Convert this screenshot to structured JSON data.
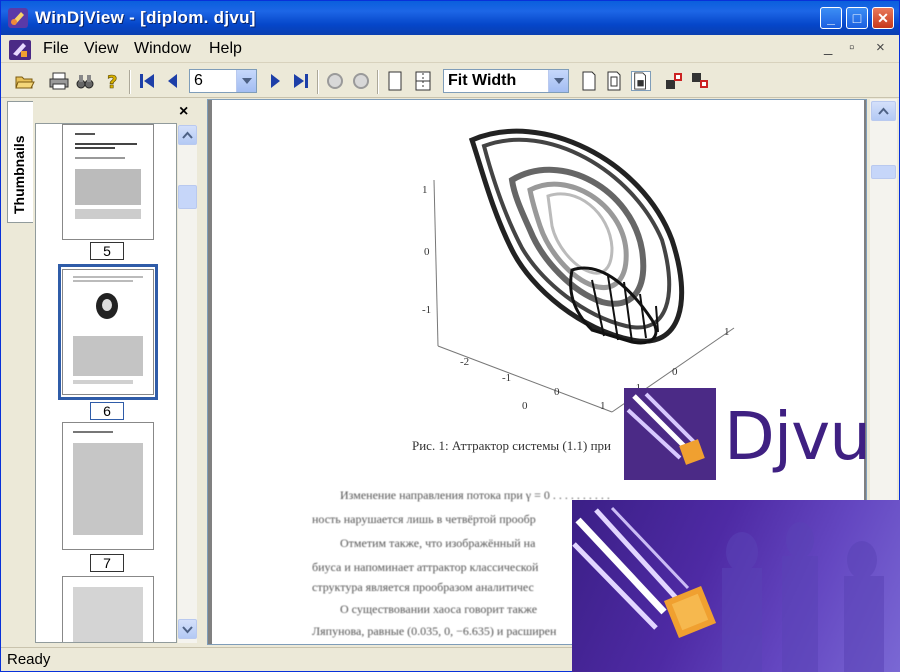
{
  "window": {
    "title": "WinDjView - [diplom. djvu]",
    "minimize": "_",
    "maximize": "□",
    "close": "✕"
  },
  "menu": {
    "items": [
      "File",
      "View",
      "Window",
      "Help"
    ],
    "right": [
      "_",
      "▫",
      "×"
    ]
  },
  "toolbar": {
    "page_value": "6",
    "zoom_value": "Fit Width"
  },
  "sidebar": {
    "tab_label": "Thumbnails",
    "close_label": "×",
    "pages": [
      "5",
      "6",
      "7"
    ],
    "selected_page": "6"
  },
  "document": {
    "axis_labels": [
      "1",
      "0",
      "-1",
      "-2",
      "-1",
      "0",
      "1",
      "-1",
      "0",
      "1",
      "0"
    ],
    "caption": "Рис. 1: Аттрактор системы (1.1) при",
    "paragraphs": [
      "Изменение направления потока при γ = 0 . . . . . . . . . .",
      "ность нарушается лишь в четвёртой прообр",
      "Отметим также, что изображённый на",
      "биуса и напоминает аттрактор классической",
      "структура является прообразом аналитичес",
      "О существовании хаоса говорит также",
      "Ляпунова, равные (0.035, 0, −6.635) и расширен"
    ]
  },
  "logo": {
    "text": "Djvu",
    "colors": {
      "purple": "#3f2082",
      "orange": "#f0a030"
    }
  },
  "status": {
    "text": "Ready"
  }
}
